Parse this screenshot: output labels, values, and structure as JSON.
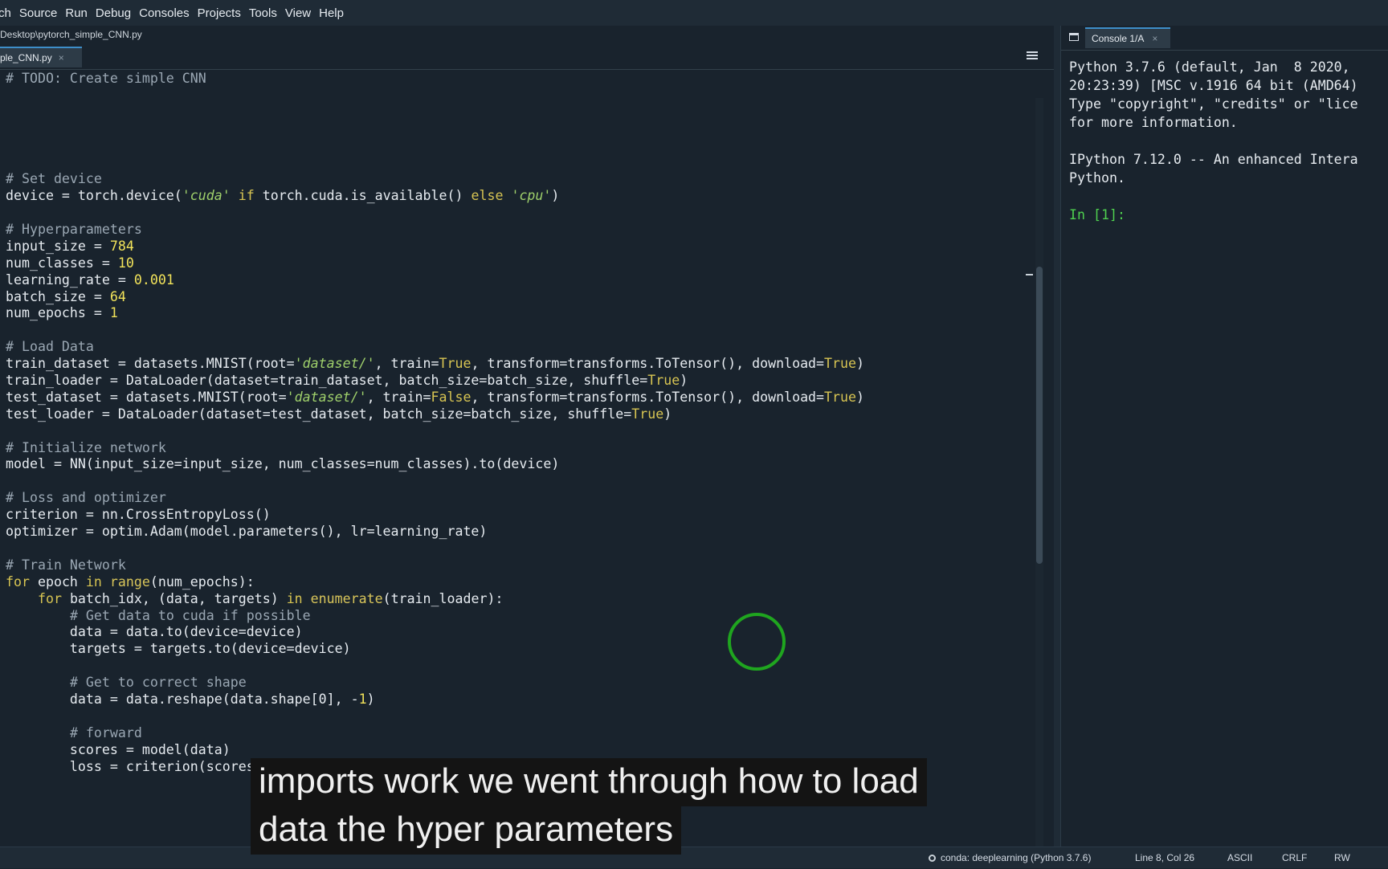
{
  "menu": [
    "rch",
    "Source",
    "Run",
    "Debug",
    "Consoles",
    "Projects",
    "Tools",
    "View",
    "Help"
  ],
  "editor": {
    "file_path": "Desktop\\pytorch_simple_CNN.py",
    "tab_label": "mple_CNN.py",
    "tab_close": "×",
    "options_icon": "hamburger-menu-icon"
  },
  "code_lines": [
    "# TODO: Create simple CNN",
    "",
    "",
    "",
    "",
    "",
    "# Set device",
    "device = torch.device('cuda' if torch.cuda.is_available() else 'cpu')",
    "",
    "# Hyperparameters",
    "input_size = 784",
    "num_classes = 10",
    "learning_rate = 0.001",
    "batch_size = 64",
    "num_epochs = 1",
    "",
    "# Load Data",
    "train_dataset = datasets.MNIST(root='dataset/', train=True, transform=transforms.ToTensor(), download=True)",
    "train_loader = DataLoader(dataset=train_dataset, batch_size=batch_size, shuffle=True)",
    "test_dataset = datasets.MNIST(root='dataset/', train=False, transform=transforms.ToTensor(), download=True)",
    "test_loader = DataLoader(dataset=test_dataset, batch_size=batch_size, shuffle=True)",
    "",
    "# Initialize network",
    "model = NN(input_size=input_size, num_classes=num_classes).to(device)",
    "",
    "# Loss and optimizer",
    "criterion = nn.CrossEntropyLoss()",
    "optimizer = optim.Adam(model.parameters(), lr=learning_rate)",
    "",
    "# Train Network",
    "for epoch in range(num_epochs):",
    "    for batch_idx, (data, targets) in enumerate(train_loader):",
    "        # Get data to cuda if possible",
    "        data = data.to(device=device)",
    "        targets = targets.to(device=device)",
    "",
    "        # Get to correct shape",
    "        data = data.reshape(data.shape[0], -1)",
    "",
    "        # forward",
    "        scores = model(data)",
    "        loss = criterion(scores, targets)"
  ],
  "console": {
    "tab_label": "Console 1/A",
    "tab_close": "×",
    "output": [
      "Python 3.7.6 (default, Jan  8 2020, ",
      "20:23:39) [MSC v.1916 64 bit (AMD64)",
      "Type \"copyright\", \"credits\" or \"lice",
      "for more information.",
      "",
      "IPython 7.12.0 -- An enhanced Intera",
      "Python.",
      ""
    ],
    "prompt": "In [1]:"
  },
  "status": {
    "conda": "conda: deeplearning (Python 3.7.6)",
    "position": "Line 8, Col 26",
    "encoding": "ASCII",
    "eol": "CRLF",
    "permissions": "RW"
  },
  "caption": [
    "imports work we went through how to load",
    "data the hyper parameters"
  ],
  "colors": {
    "background": "#19232d",
    "comment": "#9aa7b3",
    "keyword": "#d7c452",
    "string": "#9fd06b",
    "number": "#f2e35a",
    "prompt": "#4fd14f",
    "cursor_ring": "#1fa51f"
  }
}
